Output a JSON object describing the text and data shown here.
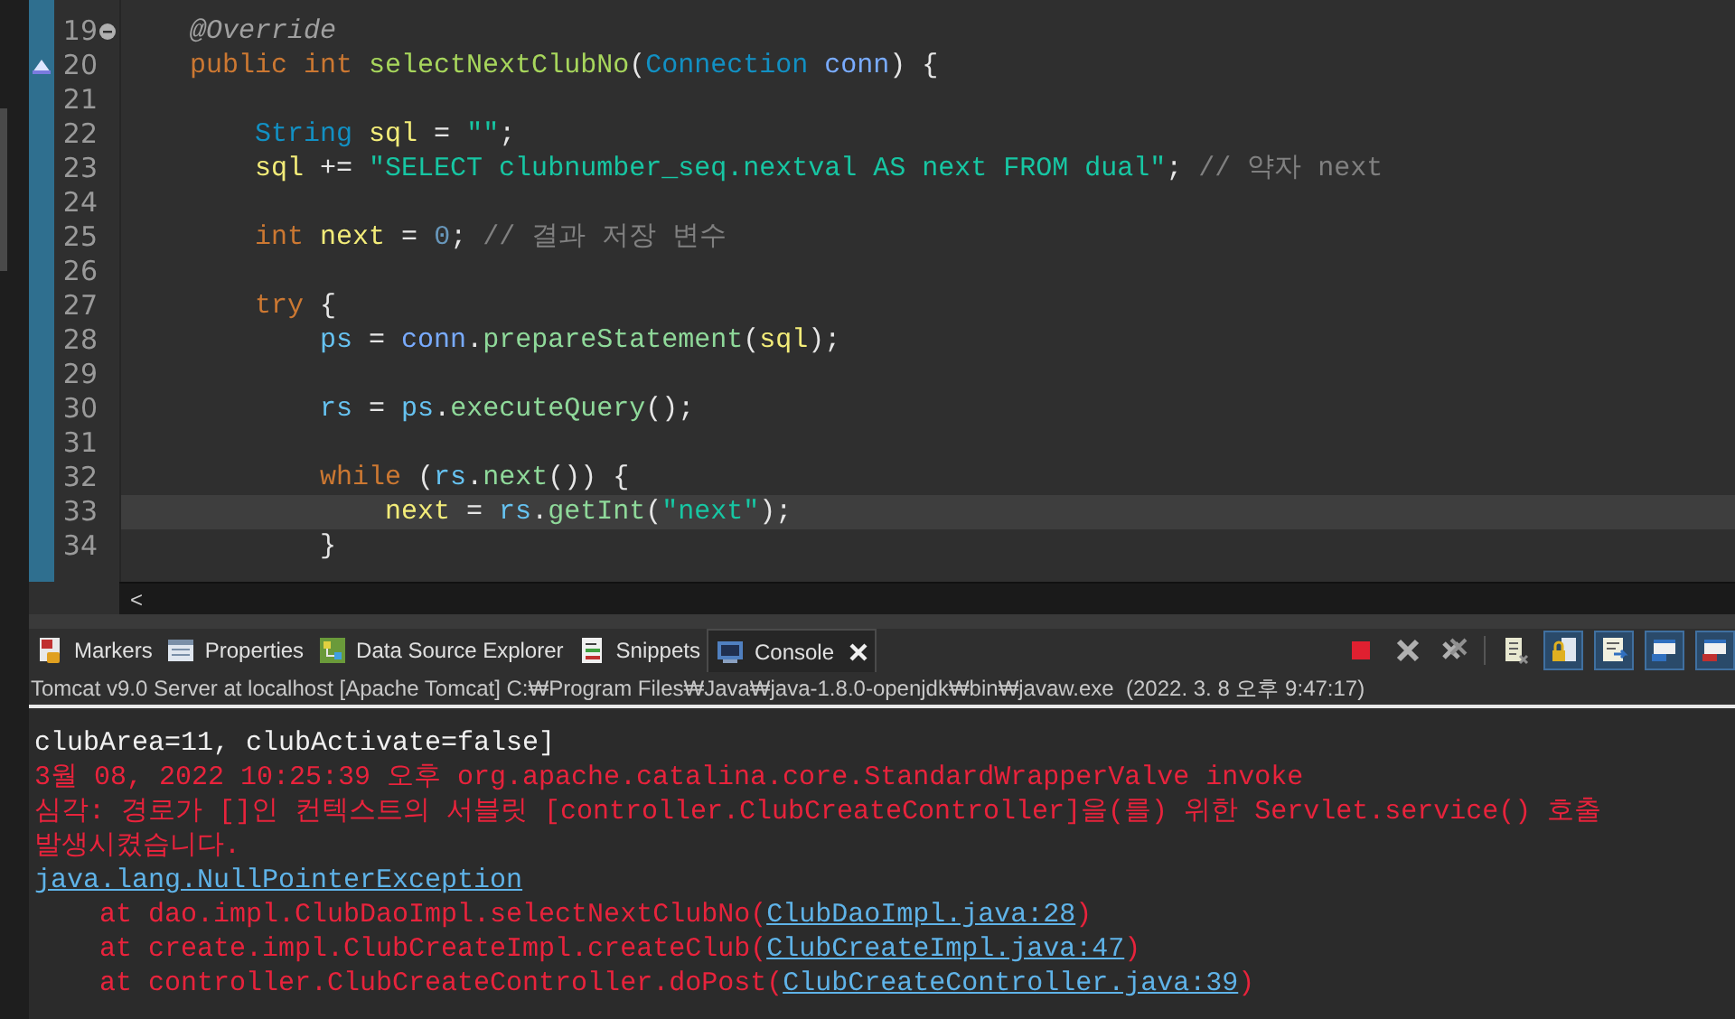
{
  "editor": {
    "lines": [
      {
        "number": "19",
        "current": false,
        "kind": "fold",
        "tokens": [
          {
            "text": "    @Override",
            "kind": "annotation"
          }
        ]
      },
      {
        "number": "20",
        "current": false,
        "kind": "override",
        "tokens": [
          {
            "text": "    public ",
            "kind": "keyword"
          },
          {
            "text": "int ",
            "kind": "keyword"
          },
          {
            "text": "selectNextClubNo",
            "kind": "method_decl"
          },
          {
            "text": "(",
            "kind": "op"
          },
          {
            "text": "Connection ",
            "kind": "type"
          },
          {
            "text": "conn",
            "kind": "param"
          },
          {
            "text": ") {",
            "kind": "op"
          }
        ]
      },
      {
        "number": "21",
        "current": false,
        "kind": "plain"
      },
      {
        "number": "22",
        "current": false,
        "kind": "plain",
        "tokens": [
          {
            "text": "        String ",
            "kind": "type"
          },
          {
            "text": "sql",
            "kind": "local"
          },
          {
            "text": " = ",
            "kind": "op"
          },
          {
            "text": "\"\"",
            "kind": "string"
          },
          {
            "text": ";",
            "kind": "op"
          }
        ]
      },
      {
        "number": "23",
        "current": false,
        "kind": "plain",
        "tokens": [
          {
            "text": "        sql",
            "kind": "local"
          },
          {
            "text": " += ",
            "kind": "op"
          },
          {
            "text": "\"SELECT clubnumber_seq.nextval AS next FROM dual\"",
            "kind": "string"
          },
          {
            "text": "; ",
            "kind": "op"
          },
          {
            "text": "// 약자 next",
            "kind": "comment"
          }
        ]
      },
      {
        "number": "24",
        "current": false,
        "kind": "plain"
      },
      {
        "number": "25",
        "current": false,
        "kind": "plain",
        "tokens": [
          {
            "text": "        int ",
            "kind": "keyword"
          },
          {
            "text": "next",
            "kind": "local"
          },
          {
            "text": " = ",
            "kind": "op"
          },
          {
            "text": "0",
            "kind": "number"
          },
          {
            "text": "; ",
            "kind": "op"
          },
          {
            "text": "// 결과 저장 변수",
            "kind": "comment"
          }
        ]
      },
      {
        "number": "26",
        "current": false,
        "kind": "plain"
      },
      {
        "number": "27",
        "current": false,
        "kind": "plain",
        "tokens": [
          {
            "text": "        try",
            "kind": "keyword"
          },
          {
            "text": " {",
            "kind": "op"
          }
        ]
      },
      {
        "number": "28",
        "current": false,
        "kind": "plain",
        "tokens": [
          {
            "text": "            ps",
            "kind": "field"
          },
          {
            "text": " = ",
            "kind": "op"
          },
          {
            "text": "conn",
            "kind": "param"
          },
          {
            "text": ".",
            "kind": "op"
          },
          {
            "text": "prepareStatement",
            "kind": "method"
          },
          {
            "text": "(",
            "kind": "op"
          },
          {
            "text": "sql",
            "kind": "local"
          },
          {
            "text": ");",
            "kind": "op"
          }
        ]
      },
      {
        "number": "29",
        "current": false,
        "kind": "plain"
      },
      {
        "number": "30",
        "current": false,
        "kind": "plain",
        "tokens": [
          {
            "text": "            rs",
            "kind": "field"
          },
          {
            "text": " = ",
            "kind": "op"
          },
          {
            "text": "ps",
            "kind": "field"
          },
          {
            "text": ".",
            "kind": "op"
          },
          {
            "text": "executeQuery",
            "kind": "method"
          },
          {
            "text": "();",
            "kind": "op"
          }
        ]
      },
      {
        "number": "31",
        "current": false,
        "kind": "plain"
      },
      {
        "number": "32",
        "current": false,
        "kind": "plain",
        "tokens": [
          {
            "text": "            while",
            "kind": "keyword"
          },
          {
            "text": " (",
            "kind": "op"
          },
          {
            "text": "rs",
            "kind": "field"
          },
          {
            "text": ".",
            "kind": "op"
          },
          {
            "text": "next",
            "kind": "method"
          },
          {
            "text": "()) {",
            "kind": "op"
          }
        ]
      },
      {
        "number": "33",
        "current": true,
        "kind": "plain",
        "tokens": [
          {
            "text": "                next",
            "kind": "local"
          },
          {
            "text": " = ",
            "kind": "op"
          },
          {
            "text": "rs",
            "kind": "field"
          },
          {
            "text": ".",
            "kind": "op"
          },
          {
            "text": "getInt",
            "kind": "method"
          },
          {
            "text": "(",
            "kind": "op"
          },
          {
            "text": "\"next\"",
            "kind": "string"
          },
          {
            "text": ");",
            "kind": "op"
          }
        ]
      },
      {
        "number": "34",
        "current": false,
        "kind": "plain",
        "tokens": [
          {
            "text": "            }",
            "kind": "op"
          }
        ]
      }
    ],
    "scroll_left": "<"
  },
  "panel": {
    "tabs": [
      {
        "label": "Markers",
        "selected": false
      },
      {
        "label": "Properties",
        "selected": false
      },
      {
        "label": "Data Source Explorer",
        "selected": false
      },
      {
        "label": "Snippets",
        "selected": false
      },
      {
        "label": "Console",
        "selected": true
      }
    ]
  },
  "console": {
    "title": "Tomcat v9.0 Server at localhost [Apache Tomcat] C:₩Program Files₩Java₩java-1.8.0-openjdk₩bin₩javaw.exe  (2022. 3. 8 오후 9:47:17)",
    "lines": [
      {
        "segments": [
          {
            "text": "clubArea=11, clubActivate=false]",
            "kind": "out"
          }
        ]
      },
      {
        "segments": [
          {
            "text": "3월 08, 2022 10:25:39 오후 org.apache.catalina.core.StandardWrapperValve invoke",
            "kind": "err"
          }
        ]
      },
      {
        "segments": [
          {
            "text": "심각: 경로가 []인 컨텍스트의 서블릿 [controller.ClubCreateController]을(를) 위한 Servlet.service() 호출",
            "kind": "err"
          }
        ]
      },
      {
        "segments": [
          {
            "text": "발생시켰습니다.",
            "kind": "err"
          }
        ]
      },
      {
        "segments": [
          {
            "text": "java.lang.NullPointerException",
            "kind": "link"
          }
        ]
      },
      {
        "segments": [
          {
            "text": "\tat dao.impl.ClubDaoImpl.selectNextClubNo(",
            "kind": "err"
          },
          {
            "text": "ClubDaoImpl.java:28",
            "kind": "link"
          },
          {
            "text": ")",
            "kind": "err"
          }
        ]
      },
      {
        "segments": [
          {
            "text": "\tat create.impl.ClubCreateImpl.createClub(",
            "kind": "err"
          },
          {
            "text": "ClubCreateImpl.java:47",
            "kind": "link"
          },
          {
            "text": ")",
            "kind": "err"
          }
        ]
      },
      {
        "segments": [
          {
            "text": "\tat controller.ClubCreateController.doPost(",
            "kind": "err"
          },
          {
            "text": "ClubCreateController.java:39",
            "kind": "link"
          },
          {
            "text": ")",
            "kind": "err"
          }
        ]
      }
    ]
  }
}
